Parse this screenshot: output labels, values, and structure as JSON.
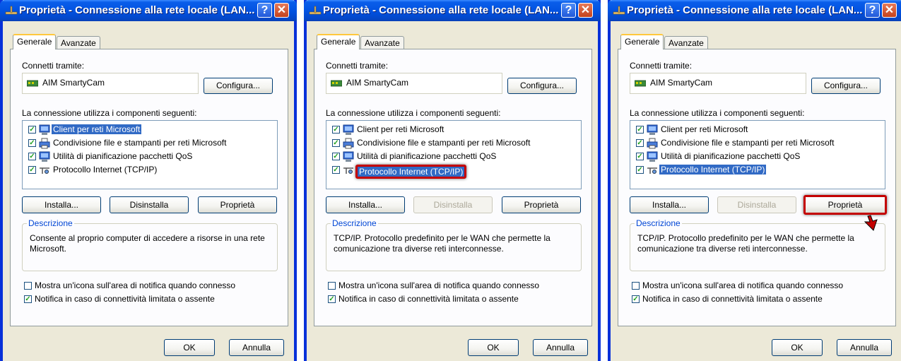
{
  "dialogs": [
    {
      "title": "Proprietà - Connessione alla rete locale (LAN...",
      "tabs": [
        "Generale",
        "Avanzate"
      ],
      "connect_via_label": "Connetti tramite:",
      "adapter_name": "AIM SmartyCam",
      "configure_label": "Configura...",
      "components_label": "La connessione utilizza i componenti seguenti:",
      "components": [
        {
          "label": "Client per reti Microsoft",
          "checked": true
        },
        {
          "label": "Condivisione file e stampanti per reti Microsoft",
          "checked": true
        },
        {
          "label": "Utilità di pianificazione pacchetti QoS",
          "checked": true
        },
        {
          "label": "Protocollo Internet (TCP/IP)",
          "checked": true
        }
      ],
      "selected_index": 0,
      "install_label": "Installa...",
      "uninstall_label": "Disinstalla",
      "properties_label": "Proprietà",
      "uninstall_enabled": true,
      "description_title": "Descrizione",
      "description_text": "Consente al proprio computer di accedere a risorse in una rete Microsoft.",
      "show_icon_label": "Mostra un'icona sull'area di notifica quando connesso",
      "show_icon_checked": false,
      "notify_label": "Notifica in caso di connettività limitata o assente",
      "notify_checked": true,
      "ok_label": "OK",
      "cancel_label": "Annulla"
    },
    {
      "title": "Proprietà - Connessione alla rete locale (LAN...",
      "tabs": [
        "Generale",
        "Avanzate"
      ],
      "connect_via_label": "Connetti tramite:",
      "adapter_name": "AIM SmartyCam",
      "configure_label": "Configura...",
      "components_label": "La connessione utilizza i componenti seguenti:",
      "components": [
        {
          "label": "Client per reti Microsoft",
          "checked": true
        },
        {
          "label": "Condivisione file e stampanti per reti Microsoft",
          "checked": true
        },
        {
          "label": "Utilità di pianificazione pacchetti QoS",
          "checked": true
        },
        {
          "label": "Protocollo Internet (TCP/IP)",
          "checked": true
        }
      ],
      "selected_index": 3,
      "install_label": "Installa...",
      "uninstall_label": "Disinstalla",
      "properties_label": "Proprietà",
      "uninstall_enabled": false,
      "description_title": "Descrizione",
      "description_text": "TCP/IP. Protocollo predefinito per le WAN che permette la comunicazione tra diverse reti interconnesse.",
      "show_icon_label": "Mostra un'icona sull'area di notifica quando connesso",
      "show_icon_checked": false,
      "notify_label": "Notifica in caso di connettività limitata o assente",
      "notify_checked": true,
      "ok_label": "OK",
      "cancel_label": "Annulla"
    },
    {
      "title": "Proprietà - Connessione alla rete locale (LAN...",
      "tabs": [
        "Generale",
        "Avanzate"
      ],
      "connect_via_label": "Connetti tramite:",
      "adapter_name": "AIM SmartyCam",
      "configure_label": "Configura...",
      "components_label": "La connessione utilizza i componenti seguenti:",
      "components": [
        {
          "label": "Client per reti Microsoft",
          "checked": true
        },
        {
          "label": "Condivisione file e stampanti per reti Microsoft",
          "checked": true
        },
        {
          "label": "Utilità di pianificazione pacchetti QoS",
          "checked": true
        },
        {
          "label": "Protocollo Internet (TCP/IP)",
          "checked": true
        }
      ],
      "selected_index": 3,
      "install_label": "Installa...",
      "uninstall_label": "Disinstalla",
      "properties_label": "Proprietà",
      "uninstall_enabled": false,
      "description_title": "Descrizione",
      "description_text": "TCP/IP. Protocollo predefinito per le WAN che permette la comunicazione tra diverse reti interconnesse.",
      "show_icon_label": "Mostra un'icona sull'area di notifica quando connesso",
      "show_icon_checked": false,
      "notify_label": "Notifica in caso di connettività limitata o assente",
      "notify_checked": true,
      "ok_label": "OK",
      "cancel_label": "Annulla"
    }
  ],
  "colors": {
    "titlebar_blue": "#0151e0",
    "dialog_face": "#ece9d8",
    "selection": "#316ac5",
    "highlight_red": "#c40000"
  }
}
